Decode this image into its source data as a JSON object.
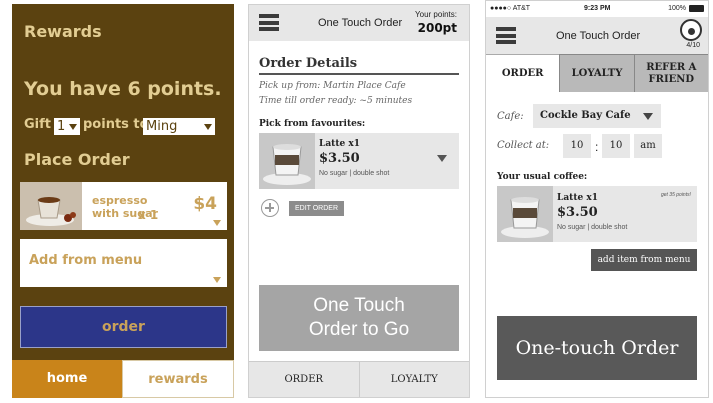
{
  "panel1": {
    "title": "Rewards",
    "points_text": "You have 6 points.",
    "gift_label": "Gift",
    "gift_qty": "1",
    "points_to": "points to",
    "recipient": "Ming",
    "place_order": "Place Order",
    "item": {
      "name": "espresso with sugar",
      "qty": "x 1",
      "price": "$4"
    },
    "add_from_menu": "Add from menu",
    "order_button": "order",
    "tabs": {
      "home": "home",
      "rewards": "rewards"
    },
    "colors": {
      "background": "#5b4210",
      "accent": "#c9841a",
      "order_button": "#2c3689"
    }
  },
  "panel2": {
    "header_title": "One Touch Order",
    "points_label": "Your points:",
    "points_value": "200pt",
    "order_details": "Order Details",
    "pickup": "Pick up from: Martin Place Cafe",
    "time": "Time till order ready: ~5 minutes",
    "favourites_label": "Pick from favourites:",
    "favourite": {
      "name": "Latte x1",
      "price": "$3.50",
      "options": "No sugar | double shot"
    },
    "edit_order": "EDIT ORDER",
    "big_button_line1": "One Touch",
    "big_button_line2": "Order to Go",
    "tabs": {
      "order": "ORDER",
      "loyalty": "LOYALTY"
    }
  },
  "panel3": {
    "status": {
      "carrier": "●●●●○ AT&T",
      "time": "9:23 PM",
      "battery": "100%"
    },
    "header_title": "One Touch Order",
    "loyalty_count": "4/10",
    "tabs": {
      "order": "ORDER",
      "loyalty": "LOYALTY",
      "refer": "REFER A FRIEND"
    },
    "cafe_label": "Cafe:",
    "cafe_value": "Cockle Bay Cafe",
    "collect_label": "Collect at:",
    "hour": "10",
    "minute": "10",
    "ampm": "am",
    "usual_label": "Your usual coffee:",
    "usual": {
      "name": "Latte x1",
      "price": "$3.50",
      "options": "No sugar | double shot",
      "bonus": "get 35 points!"
    },
    "add_item": "add item from menu",
    "big_button": "One-touch Order"
  }
}
